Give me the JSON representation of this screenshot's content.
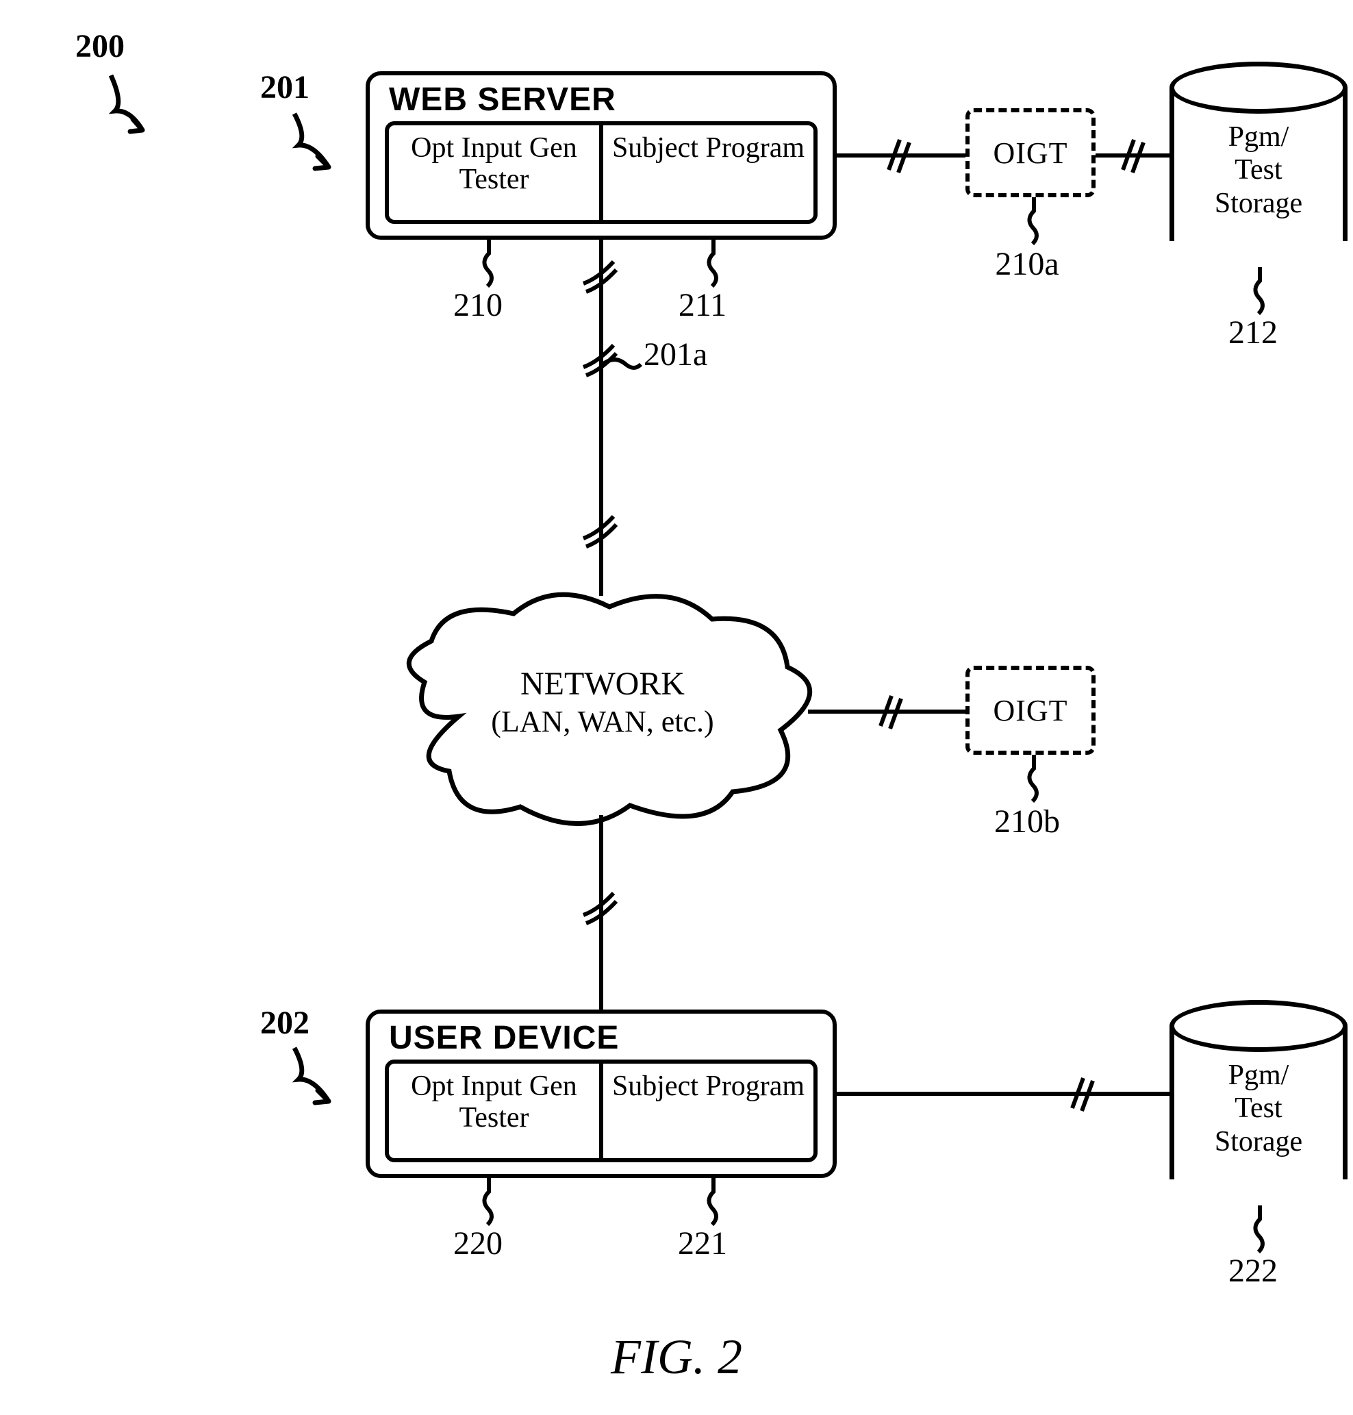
{
  "figure": {
    "title": "FIG. 2",
    "overall_ref": "200"
  },
  "webserver": {
    "ref": "201",
    "title": "WEB SERVER",
    "left_cell": "Opt Input Gen Tester",
    "right_cell": "Subject Program",
    "left_ref": "210",
    "right_ref": "211",
    "conn_ref": "201a"
  },
  "oigt_a": {
    "label": "OIGT",
    "ref": "210a"
  },
  "storage_top": {
    "line1": "Pgm/",
    "line2": "Test",
    "line3": "Storage",
    "ref": "212"
  },
  "network": {
    "line1": "NETWORK",
    "line2": "(LAN, WAN, etc.)"
  },
  "oigt_b": {
    "label": "OIGT",
    "ref": "210b"
  },
  "userdevice": {
    "ref": "202",
    "title": "USER DEVICE",
    "left_cell": "Opt Input Gen Tester",
    "right_cell": "Subject Program",
    "left_ref": "220",
    "right_ref": "221"
  },
  "storage_bot": {
    "line1": "Pgm/",
    "line2": "Test",
    "line3": "Storage",
    "ref": "222"
  }
}
